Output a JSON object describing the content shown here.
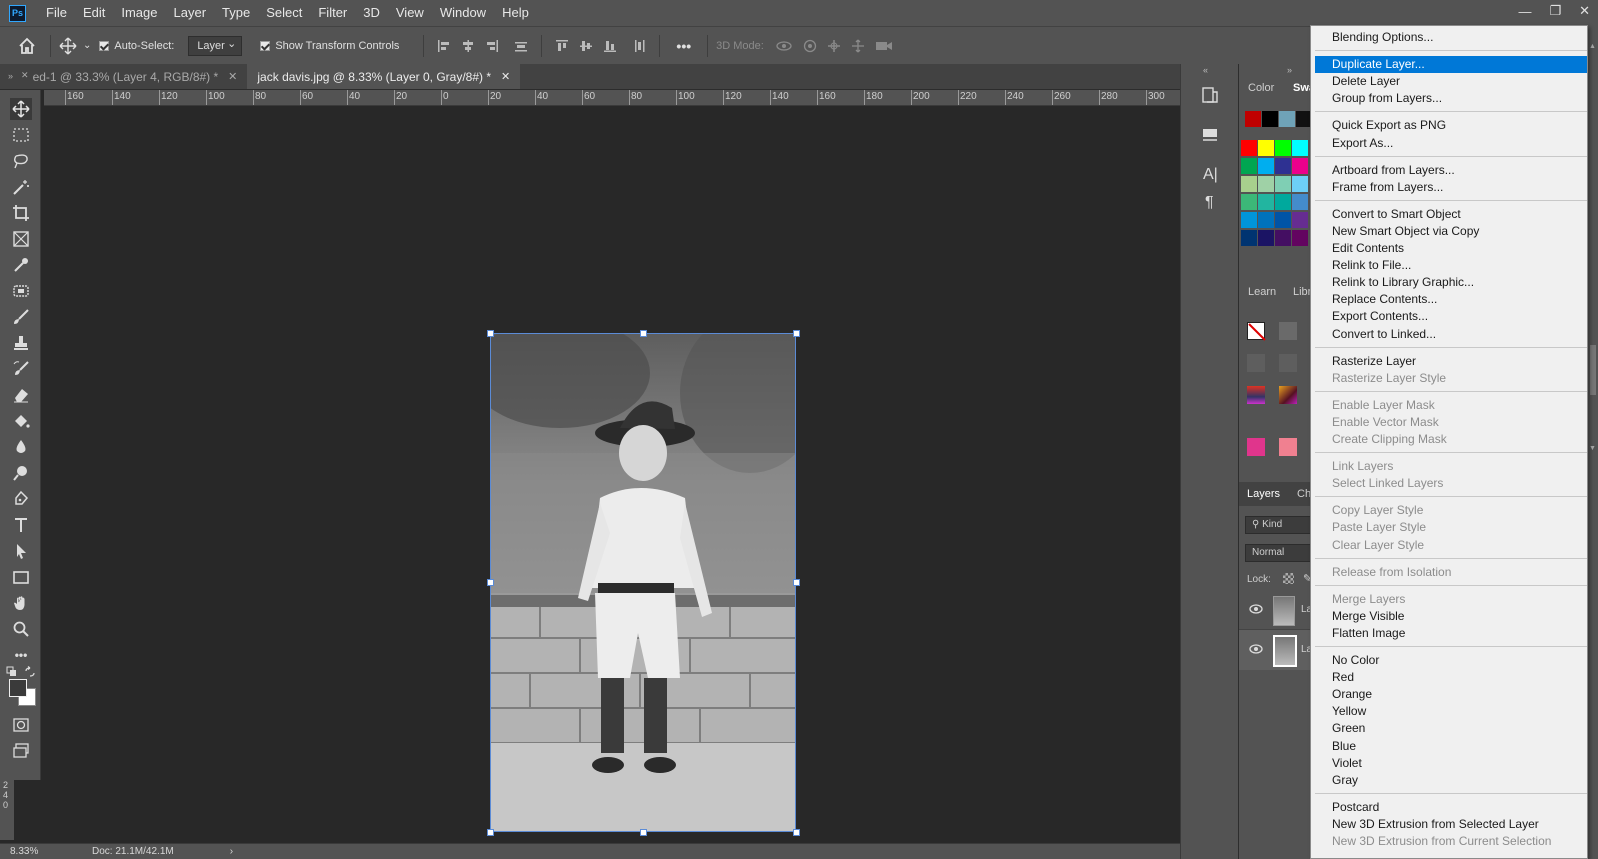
{
  "menubar": {
    "logo": "Ps",
    "items": [
      "File",
      "Edit",
      "Image",
      "Layer",
      "Type",
      "Select",
      "Filter",
      "3D",
      "View",
      "Window",
      "Help"
    ],
    "window_controls": [
      "—",
      "❐",
      "✕"
    ]
  },
  "options": {
    "auto_select_label": "Auto-Select:",
    "layer_select_value": "Layer",
    "show_transform_label": "Show Transform Controls",
    "mode_3d_label": "3D Mode:"
  },
  "tabs": [
    {
      "label": "ed-1 @ 33.3% (Layer 4, RGB/8#) *",
      "close": "✕"
    },
    {
      "label": "jack davis.jpg @ 8.33% (Layer 0, Gray/8#) *",
      "close": "✕"
    }
  ],
  "ruler_top": [
    "160",
    "140",
    "120",
    "100",
    "80",
    "60",
    "40",
    "20",
    "0",
    "20",
    "40",
    "60",
    "80",
    "100",
    "120",
    "140",
    "160",
    "180",
    "200",
    "220",
    "240",
    "260",
    "280",
    "300"
  ],
  "ruler_left": [
    "2",
    "4",
    "0"
  ],
  "statusbar": {
    "zoom": "8.33%",
    "doc": "Doc: 21.1M/42.1M",
    "arrow": "›"
  },
  "panels": {
    "color_tab": "Color",
    "swatches_tab": "Swa",
    "learn_tab": "Learn",
    "libraries_tab": "Libr",
    "layers_tab": "Layers",
    "channels_tab": "Cha",
    "kind_label": "Kind",
    "blend_mode": "Normal",
    "lock_label": "Lock:",
    "layer1_name": "La",
    "layer2_name": "La"
  },
  "swatch_colors": {
    "top": [
      "#c00000",
      "#000000",
      "#6fa3b8",
      "#111111"
    ],
    "grid": [
      [
        "#ff0000",
        "#ffff00",
        "#00ff00",
        "#00ffff"
      ],
      [
        "#00a651",
        "#00aeef",
        "#2e3192",
        "#ec008c"
      ],
      [
        "#a8d08d",
        "#9fd1a6",
        "#7fcfb4",
        "#6dcff6"
      ],
      [
        "#3cb878",
        "#22b5a0",
        "#00a99d",
        "#448ccb"
      ],
      [
        "#0095da",
        "#0072bc",
        "#0054a6",
        "#662d91"
      ],
      [
        "#003471",
        "#1b1464",
        "#440e62",
        "#630460"
      ]
    ]
  },
  "context_menu": {
    "items": [
      {
        "label": "Blending Options...",
        "state": "normal"
      },
      {
        "sep": true
      },
      {
        "label": "Duplicate Layer...",
        "state": "highlight"
      },
      {
        "label": "Delete Layer",
        "state": "normal"
      },
      {
        "label": "Group from Layers...",
        "state": "normal"
      },
      {
        "sep": true
      },
      {
        "label": "Quick Export as PNG",
        "state": "normal"
      },
      {
        "label": "Export As...",
        "state": "normal"
      },
      {
        "sep": true
      },
      {
        "label": "Artboard from Layers...",
        "state": "normal"
      },
      {
        "label": "Frame from Layers...",
        "state": "normal"
      },
      {
        "sep": true
      },
      {
        "label": "Convert to Smart Object",
        "state": "normal"
      },
      {
        "label": "New Smart Object via Copy",
        "state": "normal"
      },
      {
        "label": "Edit Contents",
        "state": "normal"
      },
      {
        "label": "Relink to File...",
        "state": "normal"
      },
      {
        "label": "Relink to Library Graphic...",
        "state": "normal"
      },
      {
        "label": "Replace Contents...",
        "state": "normal"
      },
      {
        "label": "Export Contents...",
        "state": "normal"
      },
      {
        "label": "Convert to Linked...",
        "state": "normal"
      },
      {
        "sep": true
      },
      {
        "label": "Rasterize Layer",
        "state": "normal"
      },
      {
        "label": "Rasterize Layer Style",
        "state": "disabled"
      },
      {
        "sep": true
      },
      {
        "label": "Enable Layer Mask",
        "state": "disabled"
      },
      {
        "label": "Enable Vector Mask",
        "state": "disabled"
      },
      {
        "label": "Create Clipping Mask",
        "state": "disabled"
      },
      {
        "sep": true
      },
      {
        "label": "Link Layers",
        "state": "disabled"
      },
      {
        "label": "Select Linked Layers",
        "state": "disabled"
      },
      {
        "sep": true
      },
      {
        "label": "Copy Layer Style",
        "state": "disabled"
      },
      {
        "label": "Paste Layer Style",
        "state": "disabled"
      },
      {
        "label": "Clear Layer Style",
        "state": "disabled"
      },
      {
        "sep": true
      },
      {
        "label": "Release from Isolation",
        "state": "disabled"
      },
      {
        "sep": true
      },
      {
        "label": "Merge Layers",
        "state": "disabled"
      },
      {
        "label": "Merge Visible",
        "state": "normal"
      },
      {
        "label": "Flatten Image",
        "state": "normal"
      },
      {
        "sep": true
      },
      {
        "label": "No Color",
        "state": "normal"
      },
      {
        "label": "Red",
        "state": "normal"
      },
      {
        "label": "Orange",
        "state": "normal"
      },
      {
        "label": "Yellow",
        "state": "normal"
      },
      {
        "label": "Green",
        "state": "normal"
      },
      {
        "label": "Blue",
        "state": "normal"
      },
      {
        "label": "Violet",
        "state": "normal"
      },
      {
        "label": "Gray",
        "state": "normal"
      },
      {
        "sep": true
      },
      {
        "label": "Postcard",
        "state": "normal"
      },
      {
        "label": "New 3D Extrusion from Selected Layer",
        "state": "normal"
      },
      {
        "label": "New 3D Extrusion from Current Selection",
        "state": "disabled"
      }
    ]
  },
  "tools": [
    "move-tool-icon",
    "marquee-tool-icon",
    "lasso-tool-icon",
    "magic-wand-icon",
    "crop-tool-icon",
    "frame-tool-icon",
    "eyedropper-icon",
    "healing-brush-icon",
    "brush-tool-icon",
    "clone-stamp-icon",
    "history-brush-icon",
    "eraser-icon",
    "paint-bucket-icon",
    "blur-tool-icon",
    "dodge-tool-icon",
    "pen-tool-icon",
    "type-tool-icon",
    "path-select-icon",
    "rectangle-tool-icon",
    "hand-tool-icon",
    "zoom-tool-icon",
    "more-tools-icon"
  ]
}
